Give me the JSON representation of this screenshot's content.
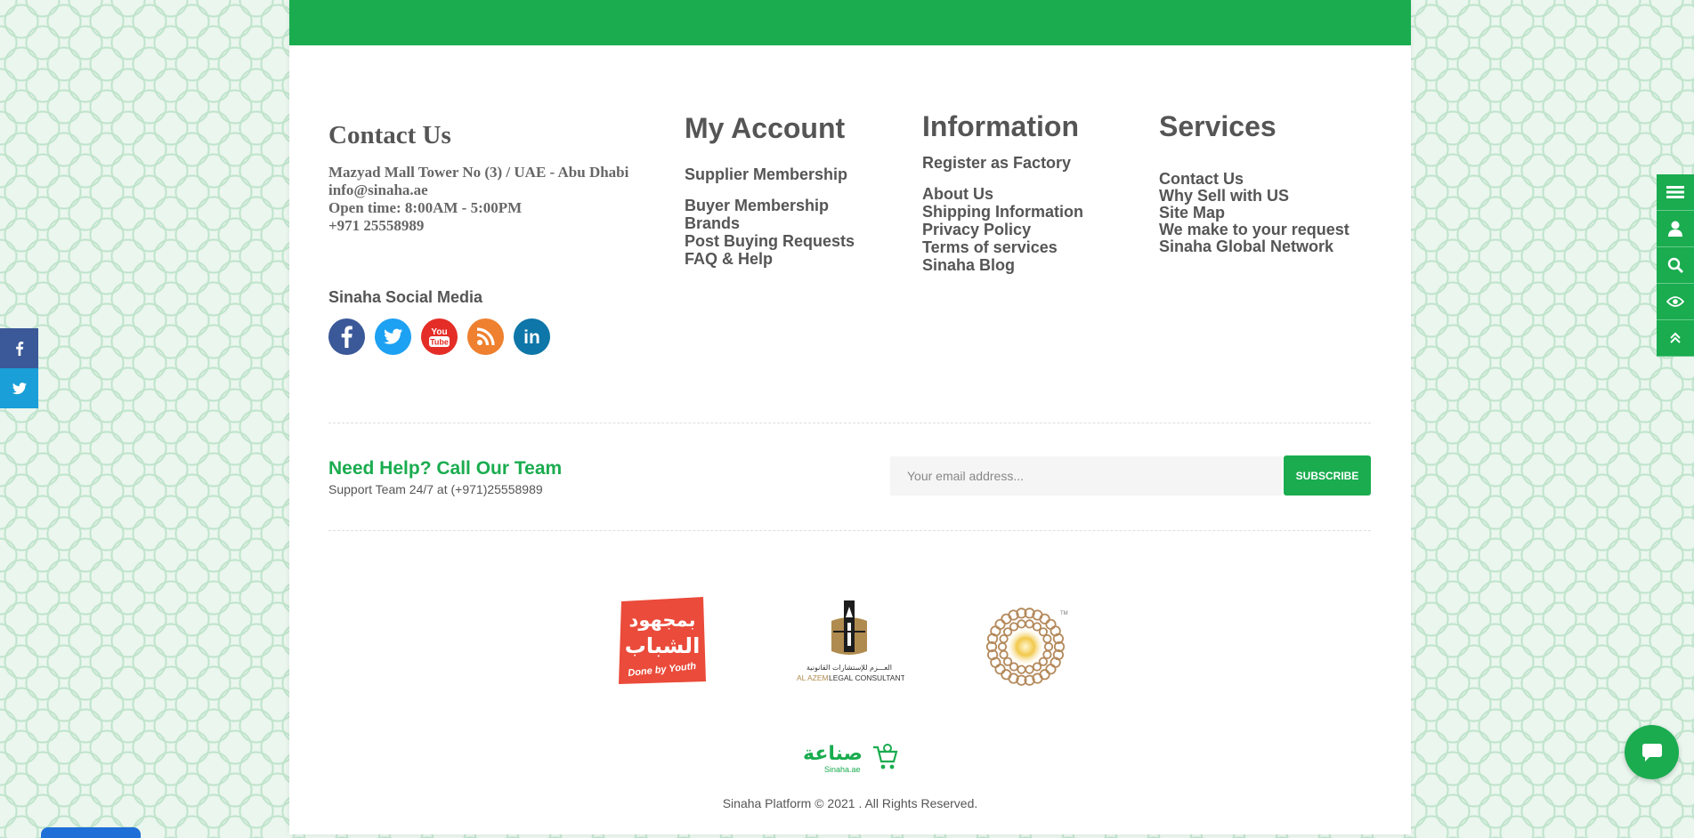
{
  "colors": {
    "brand_green": "#1aac4f",
    "text_gray": "#555555",
    "facebook": "#3b5998",
    "twitter": "#1da1f2",
    "youtube": "#e52d27",
    "rss": "#ee802f",
    "linkedin": "#0e76a8"
  },
  "contact": {
    "title": "Contact Us",
    "address": "Mazyad Mall Tower No (3) / UAE - Abu Dhabi",
    "email": "info@sinaha.ae",
    "open_time": "Open time: 8:00AM - 5:00PM",
    "phone": "+971 25558989"
  },
  "social": {
    "title": "Sinaha Social Media",
    "icons": [
      "facebook-icon",
      "twitter-icon",
      "youtube-icon",
      "rss-icon",
      "linkedin-icon"
    ],
    "youtube_you": "You",
    "youtube_tube": "Tube",
    "linkedin_text": "in"
  },
  "my_account": {
    "title": "My Account",
    "links": [
      "Supplier Membership",
      "Buyer Membership",
      "Brands",
      "Post Buying Requests",
      "FAQ & Help"
    ]
  },
  "information": {
    "title": "Information",
    "links": [
      "Register as Factory",
      "About Us",
      "Shipping Information",
      "Privacy Policy",
      "Terms of services",
      "Sinaha Blog"
    ]
  },
  "services": {
    "title": "Services",
    "links": [
      "Contact Us",
      "Why Sell with US",
      "Site Map",
      "We make to your request",
      "Sinaha Global Network"
    ]
  },
  "help": {
    "title": "Need Help? Call Our Team",
    "subtitle": "Support Team 24/7 at (+971)25558989"
  },
  "newsletter": {
    "placeholder": "Your email address...",
    "button": "SUBSCRIBE"
  },
  "partners": {
    "youth_arabic_1": "بمجهود",
    "youth_arabic_2": "الشباب",
    "youth_english": "Done by Youth",
    "alazem_arabic": "العـــزم للإستشارات القانونية",
    "alazem_prefix": "AL AZEM",
    "alazem_suffix": "LEGAL CONSULTANTS",
    "expo_tm": "TM"
  },
  "brand": {
    "arabic": "صناعة",
    "latin": "Sinaha.ae"
  },
  "copyright": "Sinaha Platform © 2021 . All Rights Reserved.",
  "side_tools": [
    "list-icon",
    "user-icon",
    "search-icon",
    "eye-icon",
    "chevron-up-icon"
  ],
  "share": [
    "facebook-icon",
    "twitter-icon"
  ]
}
